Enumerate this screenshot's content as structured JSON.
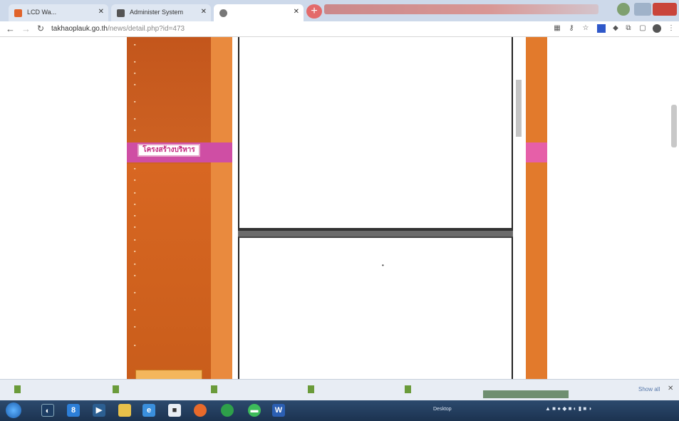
{
  "browser": {
    "tabs": [
      {
        "label": "LCD Wa...",
        "favicon_color": "#e0632a"
      },
      {
        "label": "Administer System",
        "favicon_color": "#555555"
      },
      {
        "label": "",
        "favicon_color": "#777777"
      }
    ],
    "new_tab_label": "+",
    "url_host": "takhaoplauk.go.th",
    "url_rest": "/news/detail.php?id=473"
  },
  "sidebar": {
    "items_top": [
      "",
      "",
      "",
      "",
      "",
      "",
      ""
    ],
    "highlight": "โครงสร้างบริหาร",
    "items_bottom": [
      "",
      "",
      "",
      "",
      "",
      "",
      "",
      "",
      "",
      "",
      "",
      "",
      "",
      ""
    ],
    "bottom_button": ""
  },
  "document": {
    "page1": {
      "field1_label": "",
      "field1_value": "",
      "paragraph_black": "",
      "paragraph_blue": ""
    },
    "page2": {
      "bullet": "•",
      "paragraph": "",
      "footer_label": "",
      "footer_value": ""
    }
  },
  "downloads": {
    "items": [
      "",
      "",
      "",
      "",
      ""
    ],
    "show_all": "Show all",
    "tooltip": ""
  },
  "taskbar": {
    "desktop_label": "Desktop",
    "clock_time": "",
    "clock_date": ""
  },
  "colors": {
    "sidebar": "#c3561c",
    "accent_pink": "#cf4ea4",
    "accent_orange": "#e27a2c"
  }
}
